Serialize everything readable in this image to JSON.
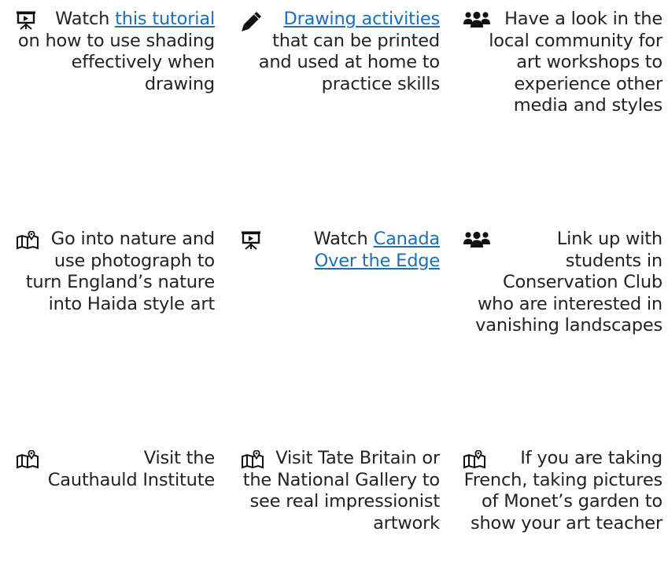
{
  "cells": [
    {
      "icon": "presentation-icon",
      "before": "Watch ",
      "link": "this tutorial",
      "after": " on how to use shading effectively when drawing"
    },
    {
      "icon": "pencil-icon",
      "before": "",
      "link": "Drawing activities",
      "after": " that can be printed and used at home to practice skills"
    },
    {
      "icon": "users-icon",
      "before": "Have a look in the local community for art workshops to experience other media and styles",
      "link": "",
      "after": ""
    },
    {
      "icon": "map-marker-icon",
      "before": "Go into nature and use photograph to turn England’s nature into Haida style art",
      "link": "",
      "after": ""
    },
    {
      "icon": "presentation-icon",
      "before": "Watch ",
      "link": "Canada Over the Edge",
      "after": ""
    },
    {
      "icon": "users-icon",
      "before": "Link up with students in Conservation Club who are interested in vanishing landscapes",
      "link": "",
      "after": ""
    },
    {
      "icon": "map-marker-icon",
      "before": "Visit the Cauthauld Institute",
      "link": "",
      "after": ""
    },
    {
      "icon": "map-marker-icon",
      "before": "Visit Tate Britain or the National Gallery to see real impressionist artwork",
      "link": "",
      "after": ""
    },
    {
      "icon": "map-marker-icon",
      "before": "If you are taking French, taking pictures of Monet’s garden to show your art teacher",
      "link": "",
      "after": ""
    }
  ]
}
